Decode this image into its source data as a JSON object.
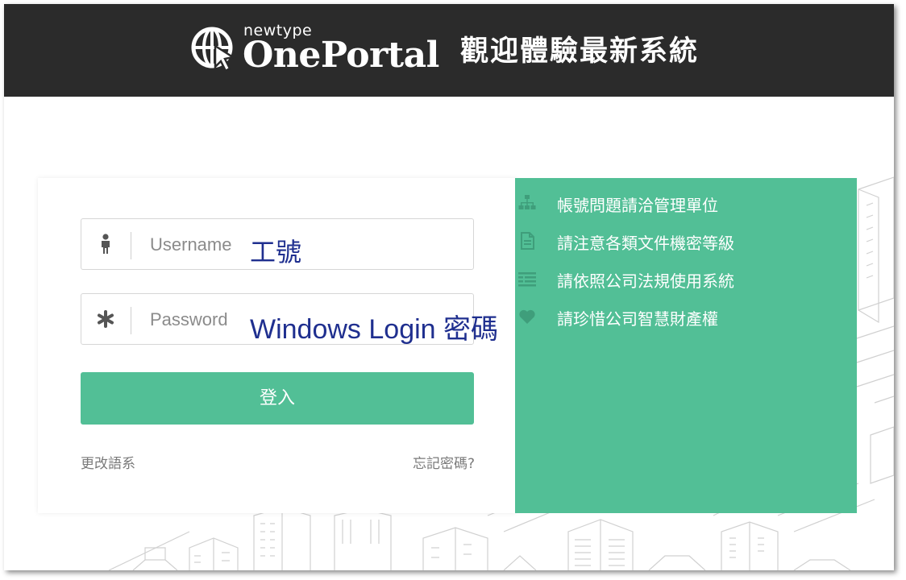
{
  "header": {
    "logo_small": "newtype",
    "logo_big": "OnePortal",
    "title": "觀迎體驗最新系統"
  },
  "login": {
    "username_placeholder": "Username",
    "username_note": "工號",
    "password_placeholder": "Password",
    "password_note": "Windows Login 密碼",
    "login_button": "登入",
    "change_language": "更改語系",
    "forgot_password": "忘記密碼?"
  },
  "info": {
    "items": [
      {
        "icon": "sitemap-icon",
        "text": "帳號問題請洽管理單位"
      },
      {
        "icon": "document-icon",
        "text": "請注意各類文件機密等級"
      },
      {
        "icon": "list-icon",
        "text": "請依照公司法規使用系統"
      },
      {
        "icon": "heart-icon",
        "text": "請珍惜公司智慧財產權"
      }
    ]
  },
  "colors": {
    "header_bg": "#2b2b2b",
    "accent_green": "#52bf96",
    "annotation_blue": "#1f2f8f"
  }
}
